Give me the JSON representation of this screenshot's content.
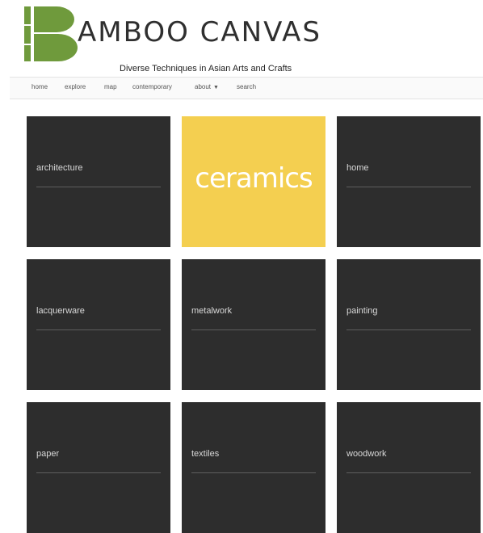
{
  "brand": {
    "logo_letter": "B",
    "name": "AMBOO CANVAS",
    "tagline": "Diverse Techniques in Asian Arts and Crafts",
    "accent_color": "#6f9a3c"
  },
  "nav": {
    "items": [
      {
        "label": "home"
      },
      {
        "label": "explore"
      },
      {
        "label": "map"
      },
      {
        "label": "contemporary"
      },
      {
        "label": "about",
        "icon": "caret-down-icon"
      },
      {
        "label": "search"
      }
    ]
  },
  "tiles": [
    {
      "label": "architecture"
    },
    {
      "label": "ceramics",
      "highlight_color": "#f4cf50"
    },
    {
      "label": "home"
    },
    {
      "label": "lacquerware"
    },
    {
      "label": "metalwork"
    },
    {
      "label": "painting"
    },
    {
      "label": "paper"
    },
    {
      "label": "textiles"
    },
    {
      "label": "woodwork"
    }
  ]
}
